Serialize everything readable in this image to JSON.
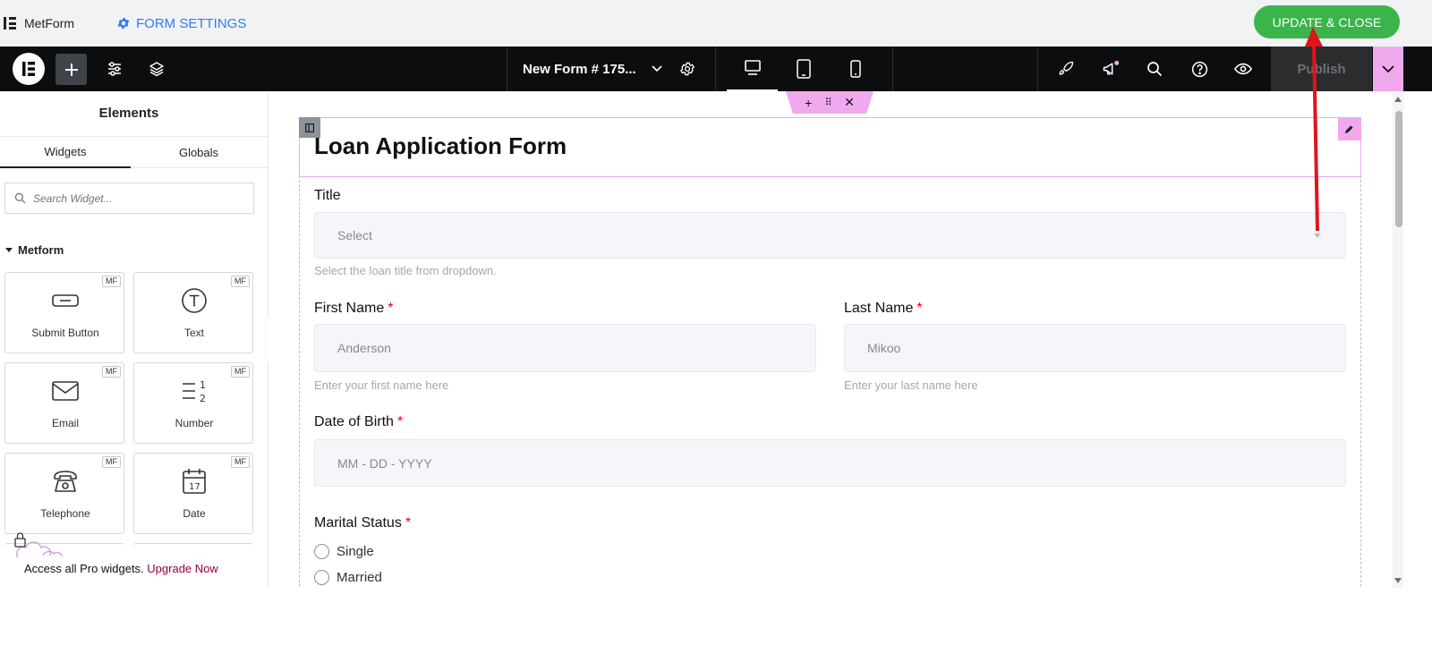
{
  "topbar": {
    "brand": "MetForm",
    "form_settings": "FORM SETTINGS",
    "update_close": "UPDATE & CLOSE",
    "accent": "#3bb44b",
    "link_color": "#2f7cf6"
  },
  "editor_bar": {
    "document_title": "New Form # 175...",
    "publish": "Publish",
    "icons": [
      "elementor-logo-icon",
      "add-element-icon",
      "site-settings-icon",
      "structure-layers-icon",
      "chevron-down-icon",
      "page-settings-gear-icon",
      "desktop-icon",
      "tablet-icon",
      "mobile-icon",
      "rocket-icon",
      "megaphone-icon",
      "search-icon",
      "help-icon",
      "preview-eye-icon"
    ]
  },
  "panel": {
    "title": "Elements",
    "tabs": [
      "Widgets",
      "Globals"
    ],
    "search_placeholder": "Search Widget...",
    "category": "Metform",
    "badge": "MF",
    "widgets": [
      {
        "label": "Submit Button",
        "icon": "button-icon"
      },
      {
        "label": "Text",
        "icon": "text-icon"
      },
      {
        "label": "Email",
        "icon": "envelope-icon"
      },
      {
        "label": "Number",
        "icon": "number-list-icon"
      },
      {
        "label": "Telephone",
        "icon": "telephone-icon"
      },
      {
        "label": "Date",
        "icon": "calendar-icon"
      }
    ],
    "upgrade_text": "Access all Pro widgets.",
    "upgrade_link": "Upgrade Now"
  },
  "form": {
    "title": "Loan Application Form",
    "title_field": {
      "label": "Title",
      "placeholder": "Select",
      "help": "Select the loan title from dropdown."
    },
    "first_name": {
      "label": "First Name",
      "required": "*",
      "placeholder": "Anderson",
      "help": "Enter your first name here"
    },
    "last_name": {
      "label": "Last Name",
      "required": "*",
      "placeholder": "Mikoo",
      "help": "Enter your last name here"
    },
    "dob": {
      "label": "Date of Birth",
      "required": "*",
      "placeholder": "MM - DD - YYYY"
    },
    "marital": {
      "label": "Marital Status",
      "required": "*",
      "options": [
        "Single",
        "Married"
      ]
    }
  },
  "colors": {
    "editor_dark": "#0c0d0e",
    "handle_pink": "#f0a9ee",
    "required_red": "#e2001a",
    "annotation_arrow": "#e0141c"
  }
}
